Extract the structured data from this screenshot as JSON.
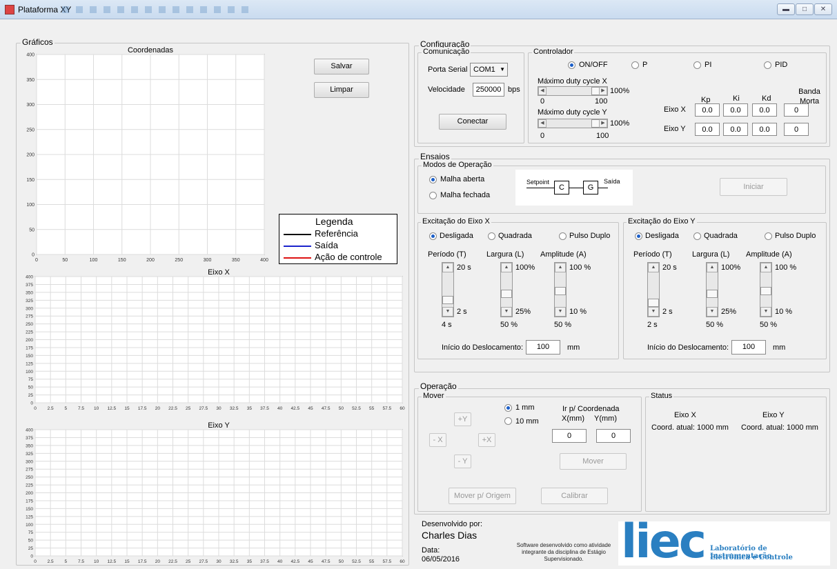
{
  "window": {
    "title": "Plataforma XY"
  },
  "graficos": {
    "title": "Gráficos",
    "save": "Salvar",
    "clear": "Limpar",
    "legend": {
      "title": "Legenda",
      "items": [
        {
          "label": "Referência",
          "color": "#000000"
        },
        {
          "label": "Saída",
          "color": "#1a22cc"
        },
        {
          "label": "Ação de controle",
          "color": "#dd1111"
        }
      ]
    },
    "coord_chart": {
      "title": "Coordenadas"
    },
    "x_chart": {
      "title": "Eixo X"
    },
    "y_chart": {
      "title": "Eixo Y"
    }
  },
  "chart_data": [
    {
      "type": "line",
      "title": "Coordenadas",
      "xlim": [
        0,
        400
      ],
      "ylim": [
        0,
        400
      ],
      "xticks": [
        0,
        50,
        100,
        150,
        200,
        250,
        300,
        350,
        400
      ],
      "yticks": [
        0,
        50,
        100,
        150,
        200,
        250,
        300,
        350,
        400
      ],
      "grid": true,
      "series": []
    },
    {
      "type": "line",
      "title": "Eixo X",
      "xlim": [
        0,
        60
      ],
      "ylim": [
        0,
        400
      ],
      "xticks": [
        0,
        2.5,
        5,
        7.5,
        10,
        12.5,
        15,
        17.5,
        20,
        22.5,
        25,
        27.5,
        30,
        32.5,
        35,
        37.5,
        40,
        42.5,
        45,
        47.5,
        50,
        52.5,
        55,
        57.5,
        60
      ],
      "yticks": [
        0,
        25,
        50,
        75,
        100,
        125,
        150,
        175,
        200,
        225,
        250,
        275,
        300,
        325,
        350,
        375,
        400
      ],
      "grid": true,
      "series": []
    },
    {
      "type": "line",
      "title": "Eixo Y",
      "xlim": [
        0,
        60
      ],
      "ylim": [
        0,
        400
      ],
      "xticks": [
        0,
        2.5,
        5,
        7.5,
        10,
        12.5,
        15,
        17.5,
        20,
        22.5,
        25,
        27.5,
        30,
        32.5,
        35,
        37.5,
        40,
        42.5,
        45,
        47.5,
        50,
        52.5,
        55,
        57.5,
        60
      ],
      "yticks": [
        0,
        25,
        50,
        75,
        100,
        125,
        150,
        175,
        200,
        225,
        250,
        275,
        300,
        325,
        350,
        375,
        400
      ],
      "grid": true,
      "series": []
    }
  ],
  "config": {
    "title": "Configuração",
    "com": {
      "title": "Comunicação",
      "port_label": "Porta Serial",
      "port_value": "COM1",
      "speed_label": "Velocidade",
      "speed_value": "250000",
      "speed_unit": "bps",
      "connect": "Conectar"
    },
    "ctrl": {
      "title": "Controlador",
      "modes": [
        "ON/OFF",
        "P",
        "PI",
        "PID"
      ],
      "selected": 0,
      "dutyx_label": "Máximo duty cycle X",
      "dutyy_label": "Máximo duty cycle Y",
      "duty_pct": "100%",
      "duty_min": "0",
      "duty_max": "100",
      "gains_headers": [
        "Kp",
        "Ki",
        "Kd",
        "Banda Morta"
      ],
      "rows": [
        {
          "label": "Eixo X",
          "values": [
            "0.0",
            "0.0",
            "0.0",
            "0"
          ]
        },
        {
          "label": "Eixo Y",
          "values": [
            "0.0",
            "0.0",
            "0.0",
            "0"
          ]
        }
      ]
    }
  },
  "ensaios": {
    "title": "Ensaios",
    "modos": {
      "title": "Modos de Operação",
      "open": "Malha aberta",
      "closed": "Malha fechada",
      "start": "Iniciar",
      "diagram": {
        "setpoint": "Setpoint",
        "c": "C",
        "g": "G",
        "out": "Saída"
      }
    },
    "exc": [
      {
        "title": "Excitação do Eixo X",
        "options": [
          "Desligada",
          "Quadrada",
          "Pulso Duplo"
        ],
        "heads": [
          "Período (T)",
          "Largura (L)",
          "Amplitude (A)"
        ],
        "tops": [
          "20 s",
          "100%",
          "100 %"
        ],
        "bots": [
          "2 s",
          "25%",
          "10 %"
        ],
        "vals": [
          "4 s",
          "50 %",
          "50 %"
        ],
        "levels": [
          0.1,
          0.333,
          0.444
        ],
        "start_label": "Início do Deslocamento:",
        "start_value": "100",
        "start_unit": "mm"
      },
      {
        "title": "Excitação do Eixo Y",
        "options": [
          "Desligada",
          "Quadrada",
          "Pulso Duplo"
        ],
        "heads": [
          "Período (T)",
          "Largura (L)",
          "Amplitude (A)"
        ],
        "tops": [
          "20 s",
          "100%",
          "100 %"
        ],
        "bots": [
          "2 s",
          "25%",
          "10 %"
        ],
        "vals": [
          "2 s",
          "50 %",
          "50 %"
        ],
        "levels": [
          0,
          0.333,
          0.444
        ],
        "start_label": "Início do Deslocamento:",
        "start_value": "100",
        "start_unit": "mm"
      }
    ]
  },
  "operacao": {
    "title": "Operação",
    "mover": {
      "title": "Mover",
      "up": "+Y",
      "left": "- X",
      "right": "+X",
      "down": "- Y",
      "step1": "1 mm",
      "step2": "10 mm",
      "goto_title": "Ir p/ Coordenada",
      "xmm": "X(mm)",
      "ymm": "Y(mm)",
      "xval": "0",
      "yval": "0",
      "move": "Mover",
      "origin": "Mover p/ Origem",
      "calibrate": "Calibrar"
    },
    "status": {
      "title": "Status",
      "x_head": "Eixo X",
      "y_head": "Eixo Y",
      "x_text": "Coord. atual: 1000  mm",
      "y_text": "Coord. atual:  1000  mm"
    }
  },
  "footer": {
    "dev_label": "Desenvolvido por:",
    "dev_name": "Charles Dias",
    "date_label": "Data:",
    "date": "06/05/2016",
    "note": "Software desenvolvido como atividade integrante da disciplina de Estágio Supervisionado.",
    "logo_text": "liec",
    "lab1": "Laboratório de Instrumentação",
    "lab2": "Eletrônica e Controle"
  }
}
